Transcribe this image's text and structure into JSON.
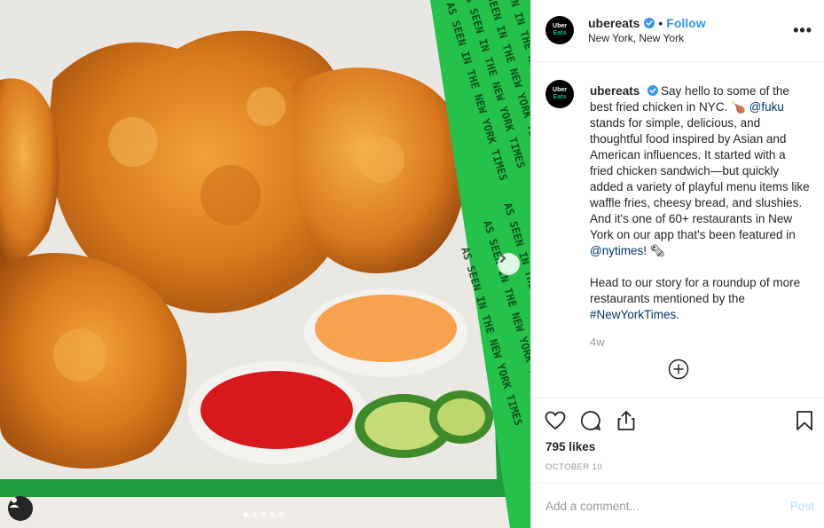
{
  "post": {
    "username": "ubereats",
    "follow_label": "Follow",
    "separator": "•",
    "location": "New York, New York",
    "more_label": "•••",
    "avatar_line1": "Uber",
    "avatar_line2": "Eats"
  },
  "media": {
    "band_text": "AS SEEN IN THE NEW YORK TIMES",
    "carousel_count": 5,
    "carousel_active_index": 0,
    "colors": {
      "band": "#24c14b",
      "tray": "#1f9c3c"
    }
  },
  "caption": {
    "username": "ubereats",
    "p1_a": "Say hello to some of the best fried chicken in NYC. 🍗 ",
    "mention_fuku": "@fuku",
    "p1_b": " stands for simple, delicious, and thoughtful food inspired by Asian and American influences. It started with a fried chicken sandwich—but quickly added a variety of playful menu items like waffle fries, cheesy bread, and slushies. And it's one of 60+ restaurants in New York on our app that's been featured in ",
    "mention_nytimes": "@nytimes",
    "p1_c": "! 🗞",
    "p2_a": "Head to our story for a roundup of more restaurants mentioned by the ",
    "hashtag": "#NewYorkTimes",
    "p2_b": ".",
    "age": "4w"
  },
  "engagement": {
    "likes": "795 likes",
    "date": "OCTOBER 10"
  },
  "comment_box": {
    "placeholder": "Add a comment...",
    "post_label": "Post"
  },
  "colors": {
    "link": "#003569",
    "follow": "#3897f0",
    "verified": "#3897f0",
    "post_disabled": "#b2dffc"
  }
}
